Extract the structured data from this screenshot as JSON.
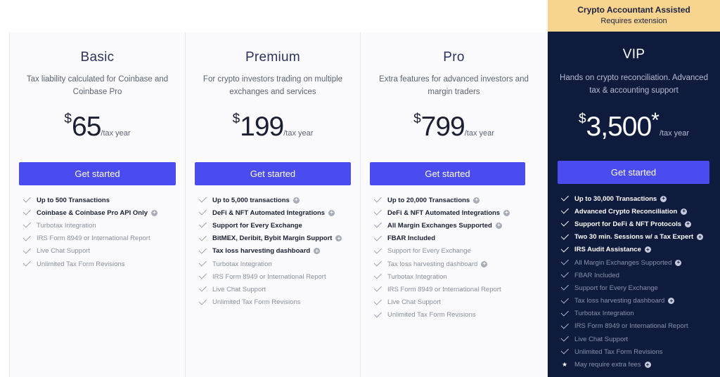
{
  "badge": {
    "line1": "Crypto Accountant Assisted",
    "line2": "Requires extension"
  },
  "plans": [
    {
      "name": "Basic",
      "description": "Tax liability calculated for Coinbase and Coinbase Pro",
      "currency": "$",
      "price": "65",
      "per": "/tax year",
      "cta": "Get started",
      "features": [
        {
          "text": "Up to 500 Transactions",
          "highlight": true,
          "info": false
        },
        {
          "text": "Coinbase & Coinbase Pro API Only",
          "highlight": true,
          "info": true
        },
        {
          "text": "Turbotax Integration",
          "highlight": false,
          "info": false
        },
        {
          "text": "IRS Form 8949 or International Report",
          "highlight": false,
          "info": false
        },
        {
          "text": "Live Chat Support",
          "highlight": false,
          "info": false
        },
        {
          "text": "Unlimited Tax Form Revisions",
          "highlight": false,
          "info": false
        }
      ]
    },
    {
      "name": "Premium",
      "description": "For crypto investors trading on multiple exchanges and services",
      "currency": "$",
      "price": "199",
      "per": "/tax year",
      "cta": "Get started",
      "features": [
        {
          "text": "Up to 5,000 transactions",
          "highlight": true,
          "info": true
        },
        {
          "text": "DeFi & NFT Automated Integrations",
          "highlight": true,
          "info": true
        },
        {
          "text": "Support for Every Exchange",
          "highlight": true,
          "info": false
        },
        {
          "text": "BitMEX, Deribit, Bybit Margin Support",
          "highlight": true,
          "info": true
        },
        {
          "text": "Tax loss harvesting dashboard",
          "highlight": true,
          "info": true
        },
        {
          "text": "Turbotax Integration",
          "highlight": false,
          "info": false
        },
        {
          "text": "IRS Form 8949 or International Report",
          "highlight": false,
          "info": false
        },
        {
          "text": "Live Chat Support",
          "highlight": false,
          "info": false
        },
        {
          "text": "Unlimited Tax Form Revisions",
          "highlight": false,
          "info": false
        }
      ]
    },
    {
      "name": "Pro",
      "description": "Extra features for advanced investors and margin traders",
      "currency": "$",
      "price": "799",
      "per": "/tax year",
      "cta": "Get started",
      "features": [
        {
          "text": "Up to 20,000 Transactions",
          "highlight": true,
          "info": true
        },
        {
          "text": "DeFi & NFT Automated Integrations",
          "highlight": true,
          "info": true
        },
        {
          "text": "All Margin Exchanges Supported",
          "highlight": true,
          "info": true
        },
        {
          "text": "FBAR Included",
          "highlight": true,
          "info": false
        },
        {
          "text": "Support for Every Exchange",
          "highlight": false,
          "info": false
        },
        {
          "text": "Tax loss harvesting dashboard",
          "highlight": false,
          "info": true
        },
        {
          "text": "Turbotax Integration",
          "highlight": false,
          "info": false
        },
        {
          "text": "IRS Form 8949 or International Report",
          "highlight": false,
          "info": false
        },
        {
          "text": "Live Chat Support",
          "highlight": false,
          "info": false
        },
        {
          "text": "Unlimited Tax Form Revisions",
          "highlight": false,
          "info": false
        }
      ]
    },
    {
      "name": "VIP",
      "description": "Hands on crypto reconciliation. Advanced tax & accounting support",
      "currency": "$",
      "price": "3,500",
      "asterisk": "*",
      "per": "/tax year",
      "cta": "Get started",
      "features": [
        {
          "text": "Up to 30,000 Transactions",
          "highlight": true,
          "info": true
        },
        {
          "text": "Advanced Crypto Reconciliation",
          "highlight": true,
          "info": true
        },
        {
          "text": "Support for DeFi & NFT Protocols",
          "highlight": true,
          "info": true
        },
        {
          "text": "Two 30 min. Sessions w/ a Tax Expert",
          "highlight": true,
          "info": true
        },
        {
          "text": "IRS Audit Assistance",
          "highlight": true,
          "info": true
        },
        {
          "text": "All Margin Exchanges Supported",
          "highlight": false,
          "info": true
        },
        {
          "text": "FBAR Included",
          "highlight": false,
          "info": false
        },
        {
          "text": "Support for Every Exchange",
          "highlight": false,
          "info": false
        },
        {
          "text": "Tax loss harvesting dashboard",
          "highlight": false,
          "info": true
        },
        {
          "text": "Turbotax Integration",
          "highlight": false,
          "info": false
        },
        {
          "text": "IRS Form 8949 or International Report",
          "highlight": false,
          "info": false
        },
        {
          "text": "Live Chat Support",
          "highlight": false,
          "info": false
        },
        {
          "text": "Unlimited Tax Form Revisions",
          "highlight": false,
          "info": false
        },
        {
          "text": "May require extra fees",
          "highlight": false,
          "info": true,
          "marker": "star"
        }
      ]
    }
  ],
  "colors": {
    "accent": "#4a4cf0",
    "vip_bg": "#0f1b3d",
    "badge_bg": "#f9d48f"
  }
}
